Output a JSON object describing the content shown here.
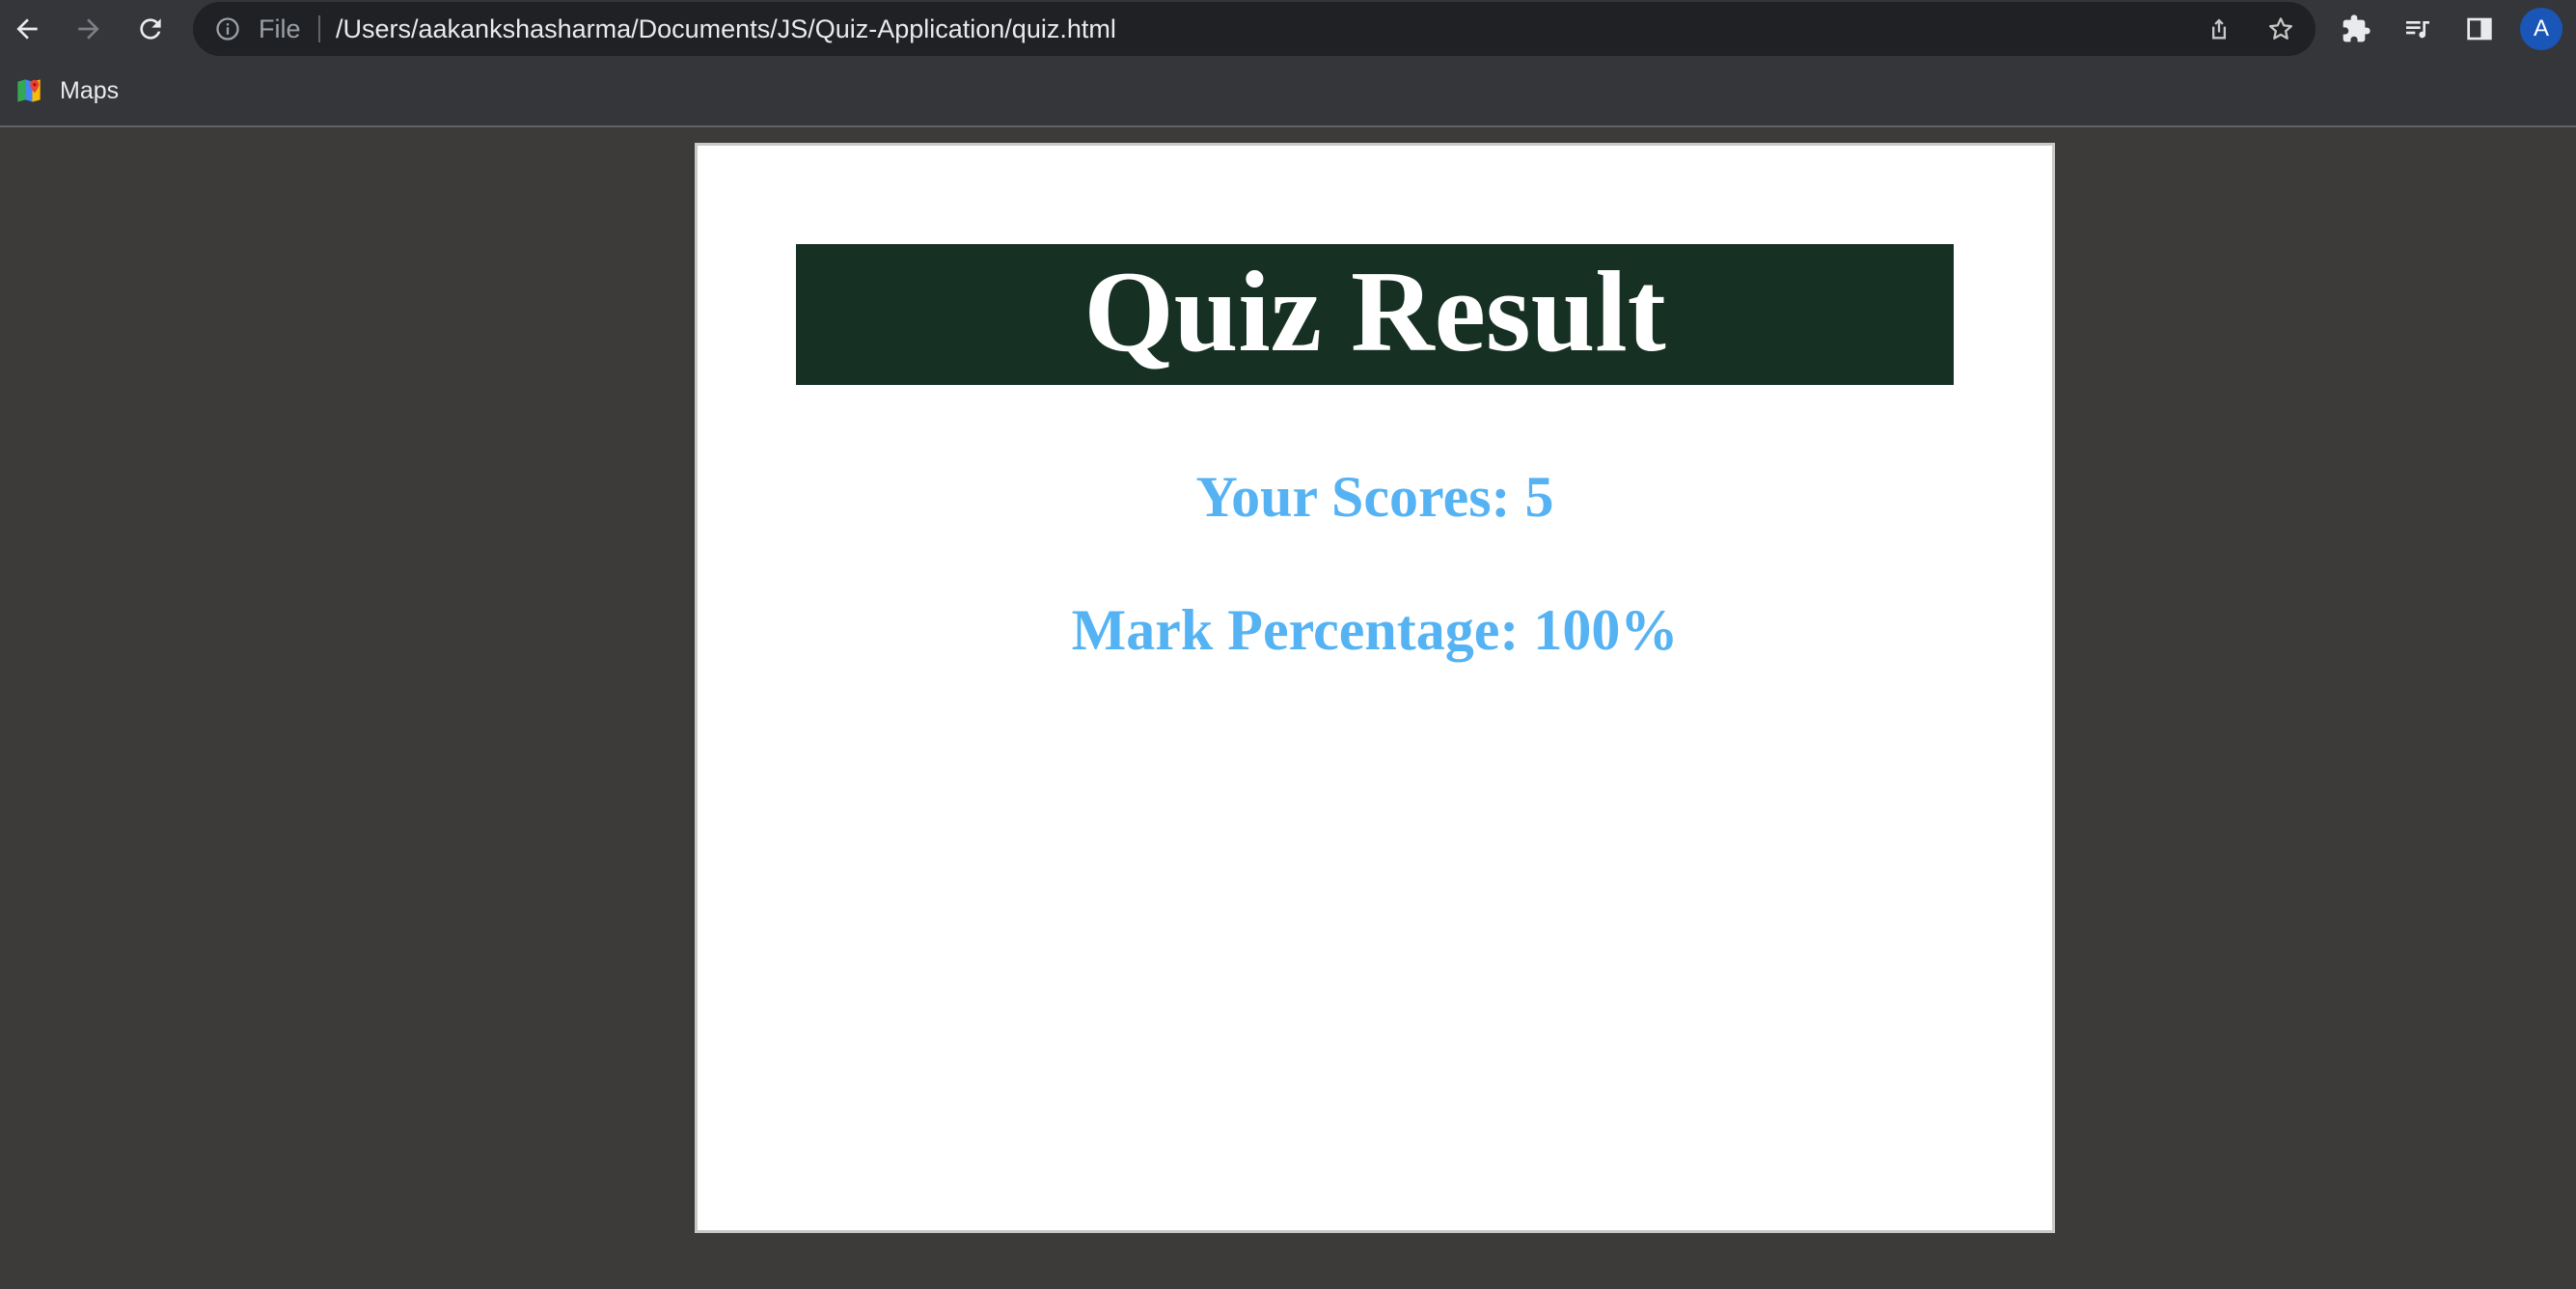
{
  "browser": {
    "url_scheme_label": "File",
    "url": "/Users/aakankshasharma/Documents/JS/Quiz-Application/quiz.html",
    "profile_initial": "A",
    "icons": {
      "back": "back-arrow-icon",
      "forward": "forward-arrow-icon",
      "reload": "reload-icon",
      "site_info": "info-icon",
      "share": "share-icon",
      "bookmark": "star-icon",
      "extensions": "puzzle-icon",
      "media": "media-queue-icon",
      "side_panel": "side-panel-icon"
    }
  },
  "bookmarks": [
    {
      "label": "Maps",
      "icon": "maps-icon"
    }
  ],
  "quiz_result": {
    "title": "Quiz Result",
    "score_text": "Your Scores: 5",
    "percentage_text": "Mark Percentage: 100%"
  },
  "colors": {
    "banner_bg": "#163124",
    "score_text": "#55b3f3",
    "page_bg": "#3c3b39"
  }
}
